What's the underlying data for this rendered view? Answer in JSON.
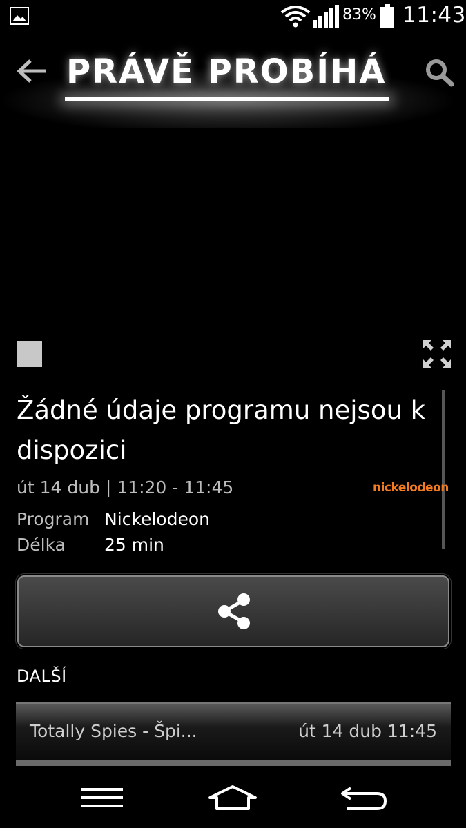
{
  "status_bar": {
    "battery_percent": "83%",
    "time": "11:43",
    "icons": [
      "image-icon",
      "wifi-icon",
      "signal-icon",
      "battery-icon"
    ]
  },
  "header": {
    "title": "PRÁVĚ PROBÍHÁ",
    "back_icon": "arrow-left-icon",
    "search_icon": "search-icon"
  },
  "player": {
    "stop_icon": "stop-icon",
    "fullscreen_icon": "fullscreen-icon"
  },
  "program": {
    "title_line1": "Žádné údaje programu nejsou k",
    "title_line2": "dispozici",
    "datetime": "út 14 dub | 11:20 - 11:45",
    "channel_logo": "nickelodeon",
    "program_label": "Program",
    "program_value": "Nickelodeon",
    "length_label": "Délka",
    "length_value": "25 min"
  },
  "share": {
    "icon": "share-icon"
  },
  "next": {
    "heading": "DALŠÍ",
    "items": [
      {
        "title": "Totally Spies - Špi...",
        "time": "út 14 dub 11:45"
      }
    ]
  },
  "nav": {
    "icons": [
      "menu-icon",
      "home-icon",
      "back-icon"
    ]
  },
  "colors": {
    "background": "#000000",
    "accent_logo": "#f47b20",
    "secondary_text": "#bdbdbd"
  }
}
